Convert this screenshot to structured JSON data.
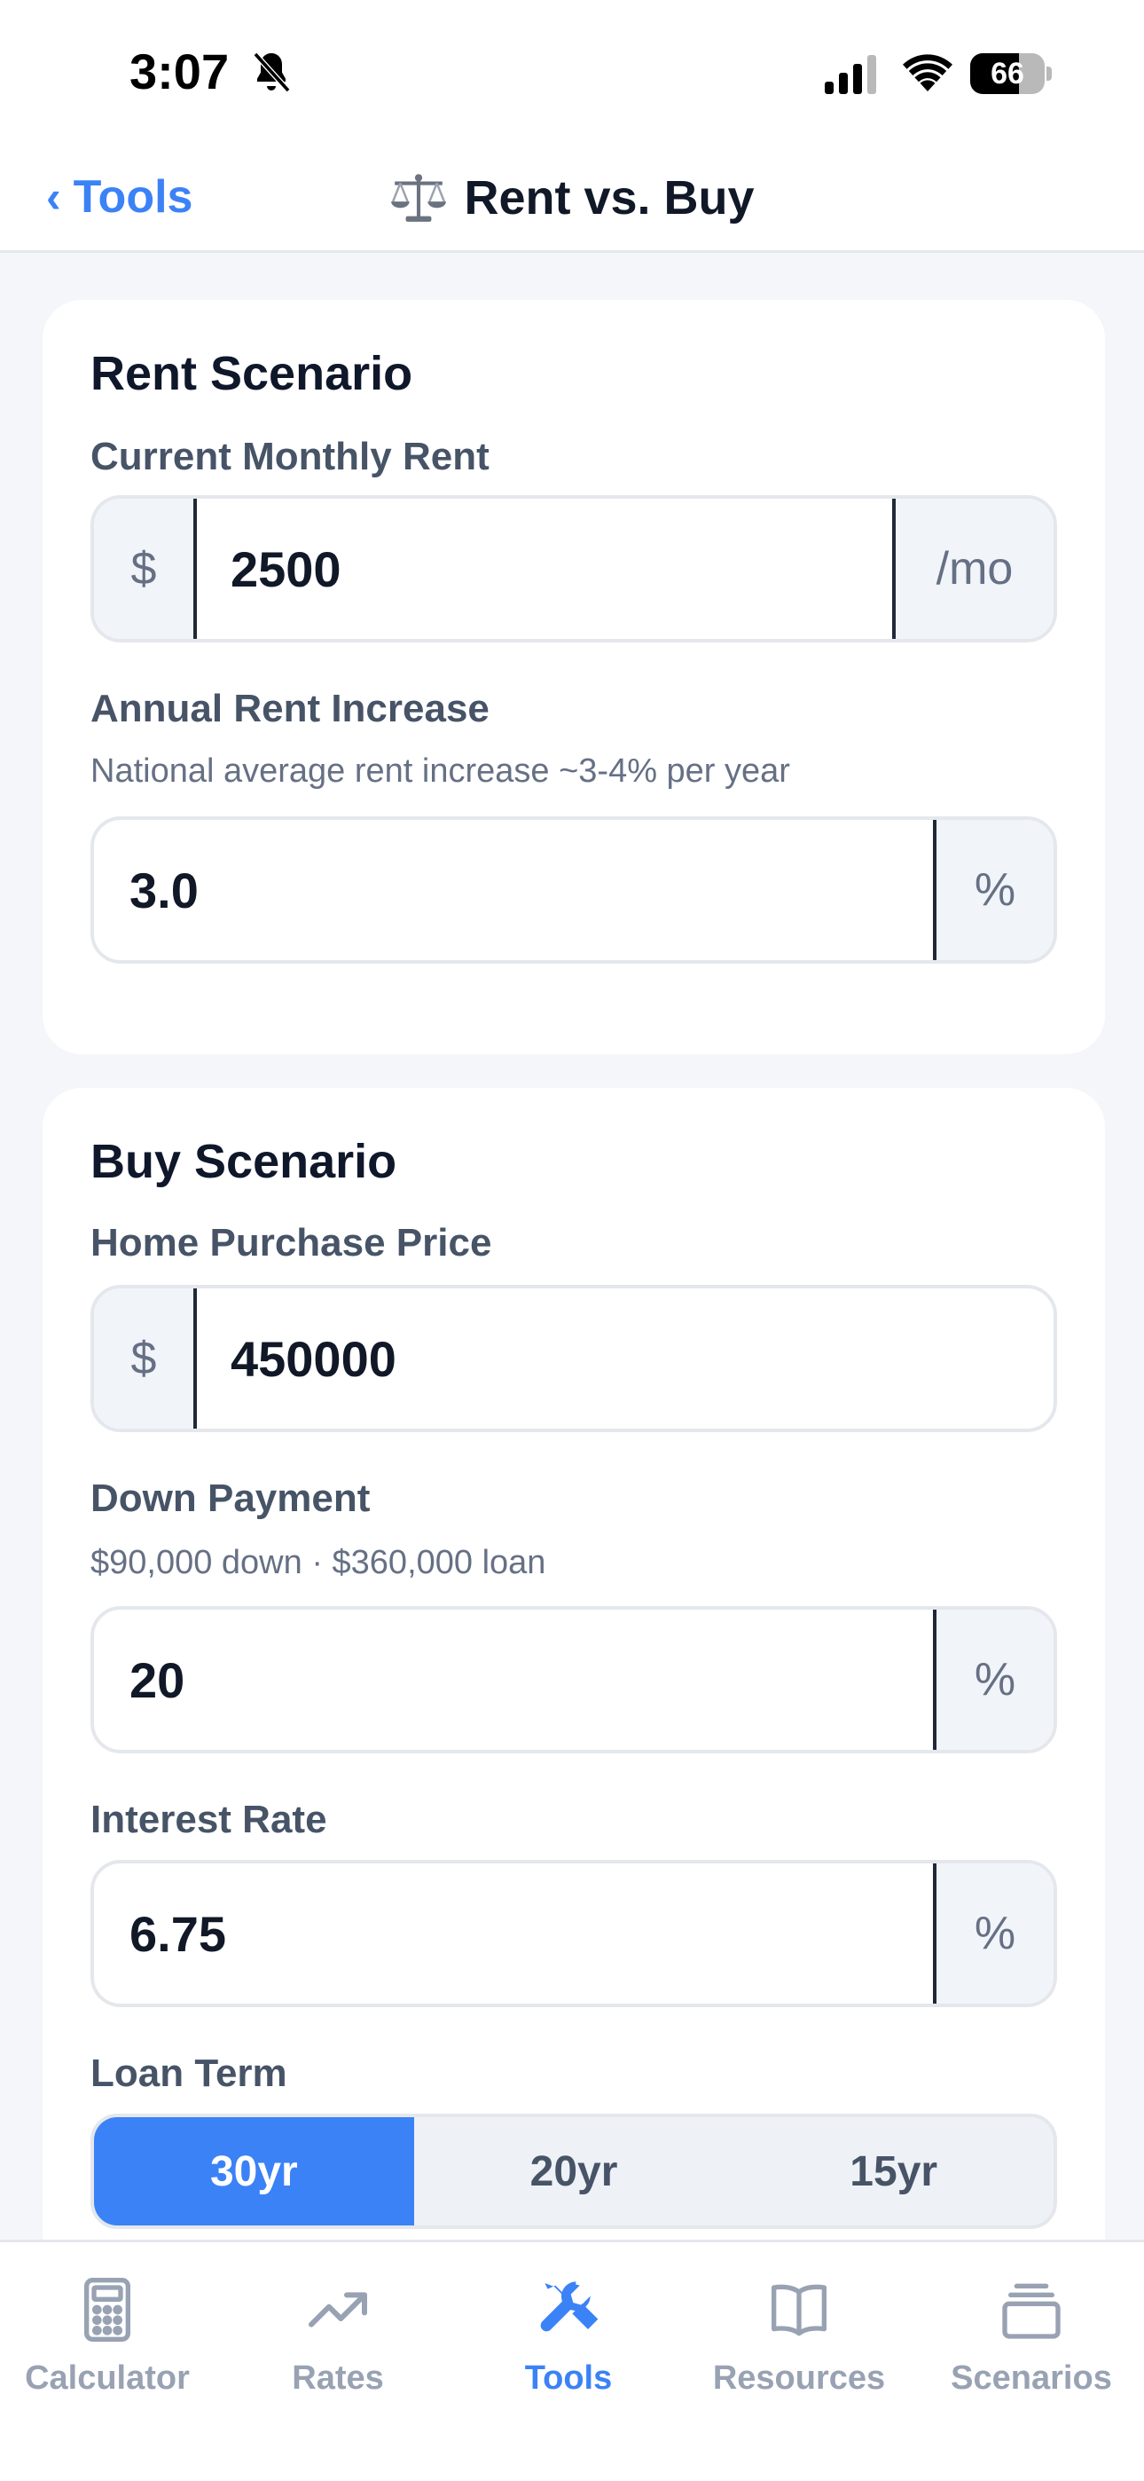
{
  "status_bar": {
    "time": "3:07",
    "battery_level": 66,
    "battery_text": "66"
  },
  "nav": {
    "back_label": "Tools",
    "title": "Rent vs. Buy"
  },
  "rent_scenario": {
    "title": "Rent Scenario",
    "monthly_rent": {
      "label": "Current Monthly Rent",
      "prefix": "$",
      "value": "2500",
      "suffix": "/mo"
    },
    "rent_increase": {
      "label": "Annual Rent Increase",
      "hint": "National average rent increase ~3-4% per year",
      "value": "3.0",
      "suffix": "%"
    }
  },
  "buy_scenario": {
    "title": "Buy Scenario",
    "purchase_price": {
      "label": "Home Purchase Price",
      "prefix": "$",
      "value": "450000"
    },
    "down_payment": {
      "label": "Down Payment",
      "hint": "$90,000 down · $360,000 loan",
      "value": "20",
      "suffix": "%"
    },
    "interest_rate": {
      "label": "Interest Rate",
      "value": "6.75",
      "suffix": "%"
    },
    "loan_term": {
      "label": "Loan Term",
      "options": [
        "30yr",
        "20yr",
        "15yr"
      ],
      "selected": "30yr"
    }
  },
  "tab_bar": {
    "tabs": [
      {
        "label": "Calculator",
        "icon": "calculator-icon",
        "active": false
      },
      {
        "label": "Rates",
        "icon": "trending-up-icon",
        "active": false
      },
      {
        "label": "Tools",
        "icon": "tools-icon",
        "active": true
      },
      {
        "label": "Resources",
        "icon": "book-icon",
        "active": false
      },
      {
        "label": "Scenarios",
        "icon": "stack-icon",
        "active": false
      }
    ]
  },
  "colors": {
    "accent": "#3b82f6",
    "background": "#f4f6f9",
    "card": "#ffffff",
    "muted": "#98a2b3"
  }
}
